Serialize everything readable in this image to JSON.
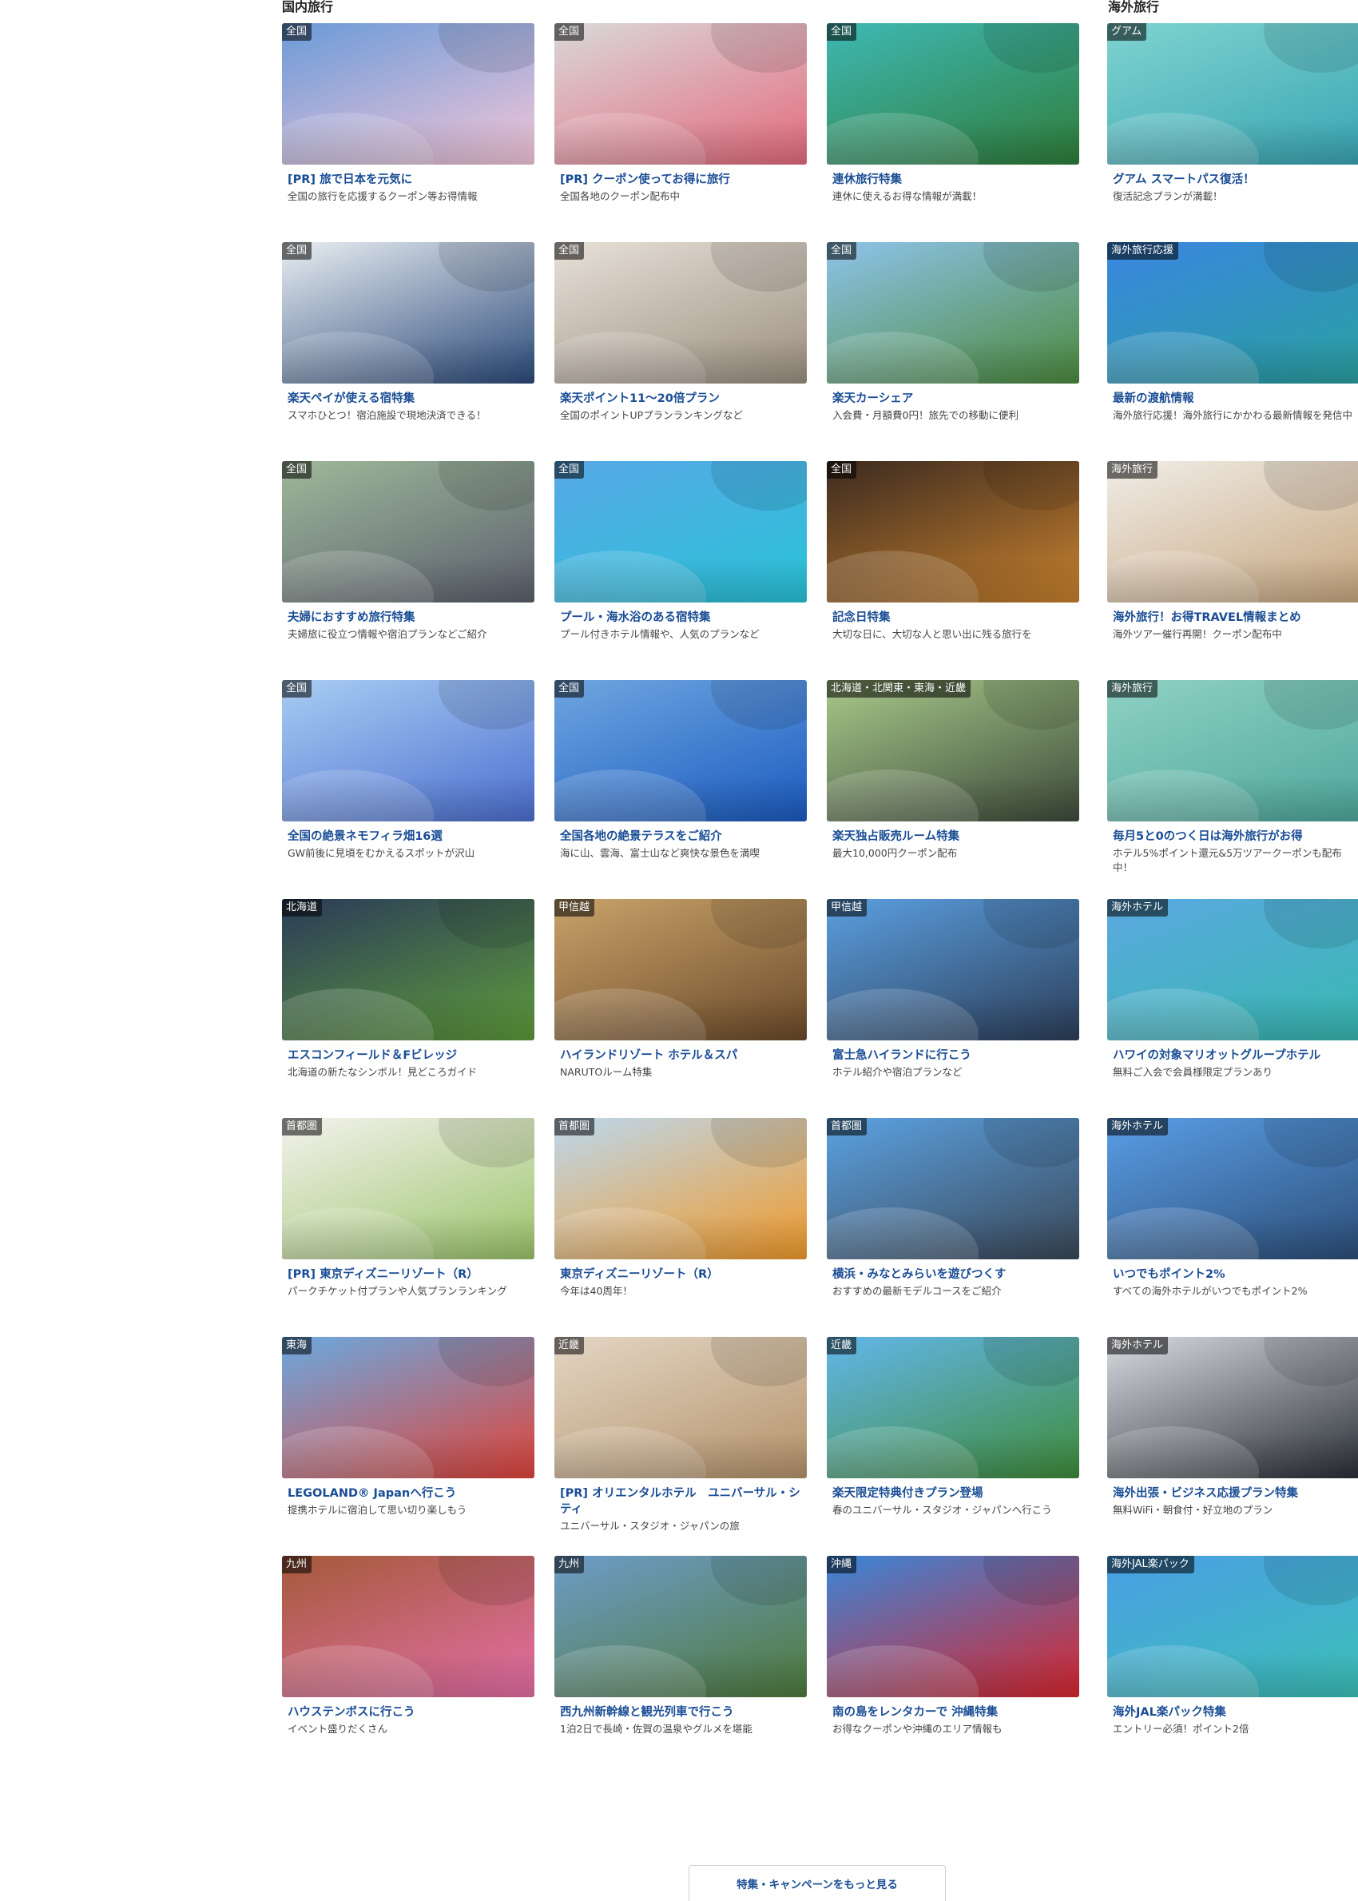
{
  "domestic": {
    "heading": "国内旅行",
    "cards": [
      {
        "badge": "全国",
        "title": "[PR] 旅で日本を元気に",
        "desc": "全国の旅行を応援するクーポン等お得情報",
        "c1": "#6a9ad8",
        "c2": "#f4c6d8"
      },
      {
        "badge": "全国",
        "title": "[PR] クーポン使ってお得に旅行",
        "desc": "全国各地のクーポン配布中",
        "c1": "#d9d9d9",
        "c2": "#e46a7e"
      },
      {
        "badge": "全国",
        "title": "連休旅行特集",
        "desc": "連休に使えるお得な情報が満載！",
        "c1": "#3fb8b4",
        "c2": "#2f7d3a"
      },
      {
        "badge": "全国",
        "title": "楽天ペイが使える宿特集",
        "desc": "スマホひとつ！宿泊施設で現地決済できる！",
        "c1": "#e9eef2",
        "c2": "#2c4a7a"
      },
      {
        "badge": "全国",
        "title": "楽天ポイント11～20倍プラン",
        "desc": "全国のポイントUPプランランキングなど",
        "c1": "#e7e1d8",
        "c2": "#9b8e80"
      },
      {
        "badge": "全国",
        "title": "楽天カーシェア",
        "desc": "入会費・月額費0円！旅先での移動に便利",
        "c1": "#8ec3ea",
        "c2": "#4c8a3e"
      },
      {
        "badge": "全国",
        "title": "夫婦におすすめ旅行特集",
        "desc": "夫婦旅に役立つ情報や宿泊プランなどご紹介",
        "c1": "#9fb89a",
        "c2": "#5a5f6d"
      },
      {
        "badge": "全国",
        "title": "プール・海水浴のある宿特集",
        "desc": "プール付きホテル情報や、人気のプランなど",
        "c1": "#58a8e6",
        "c2": "#28c3d8"
      },
      {
        "badge": "全国",
        "title": "記念日特集",
        "desc": "大切な日に、大切な人と思い出に残る旅行を",
        "c1": "#3b2a20",
        "c2": "#c9822e"
      },
      {
        "badge": "全国",
        "title": "全国の絶景ネモフィラ畑16選",
        "desc": "GW前後に見頃をむかえるスポットが沢山",
        "c1": "#a9cdf2",
        "c2": "#4c6fd0"
      },
      {
        "badge": "全国",
        "title": "全国各地の絶景テラスをご紹介",
        "desc": "海に山、雲海、富士山など爽快な景色を満喫",
        "c1": "#6fa6e0",
        "c2": "#1b5bc0"
      },
      {
        "badge": "北海道・北関東・東海・近畿",
        "title": "楽天独占販売ルーム特集",
        "desc": "最大10,000円クーポン配布",
        "c1": "#a8c98a",
        "c2": "#3d4a3a"
      },
      {
        "badge": "北海道",
        "title": "エスコンフィールド＆Fビレッジ",
        "desc": "北海道の新たなシンボル！見どころガイド",
        "c1": "#2b3b58",
        "c2": "#5e9b3c"
      },
      {
        "badge": "甲信越",
        "title": "ハイランドリゾート ホテル＆スパ",
        "desc": "NARUTOルーム特集",
        "c1": "#c9a36a",
        "c2": "#6b4a2a"
      },
      {
        "badge": "甲信越",
        "title": "富士急ハイランドに行こう",
        "desc": "ホテル紹介や宿泊プランなど",
        "c1": "#5b9fe0",
        "c2": "#2c3e58"
      },
      {
        "badge": "首都圏",
        "title": "[PR] 東京ディズニーリゾート（R）",
        "desc": "パークチケット付プランや人気プランランキング",
        "c1": "#f4f2ee",
        "c2": "#9bc46a"
      },
      {
        "badge": "首都圏",
        "title": "東京ディズニーリゾート（R）",
        "desc": "今年は40周年！",
        "c1": "#bcd8ee",
        "c2": "#f09a2a"
      },
      {
        "badge": "首都圏",
        "title": "横浜・みなとみらいを遊びつくす",
        "desc": "おすすめの最新モデルコースをご紹介",
        "c1": "#5ba2e2",
        "c2": "#3a4756"
      },
      {
        "badge": "東海",
        "title": "LEGOLAND® Japanへ行こう",
        "desc": "提携ホテルに宿泊して思い切り楽しもう",
        "c1": "#6aa9e0",
        "c2": "#e0443a"
      },
      {
        "badge": "近畿",
        "title": "[PR] オリエンタルホテル　ユニバーサル・シティ",
        "desc": "ユニバーサル・スタジオ・ジャパンの旅",
        "c1": "#e3d6c4",
        "c2": "#b4926a"
      },
      {
        "badge": "近畿",
        "title": "楽天限定特典付きプラン登場",
        "desc": "春のユニバーサル・スタジオ・ジャパンへ行こう",
        "c1": "#63b6ea",
        "c2": "#3f8c3a"
      },
      {
        "badge": "九州",
        "title": "ハウステンボスに行こう",
        "desc": "イベント盛りだくさん",
        "c1": "#a45a3a",
        "c2": "#e46fa6"
      },
      {
        "badge": "九州",
        "title": "西九州新幹線と観光列車で行こう",
        "desc": "1泊2日で長崎・佐賀の温泉やグルメを堪能",
        "c1": "#6d9cc8",
        "c2": "#4f7a3c"
      },
      {
        "badge": "沖縄",
        "title": "南の島をレンタカーで 沖縄特集",
        "desc": "お得なクーポンや沖縄のエリア情報も",
        "c1": "#3a86d8",
        "c2": "#d9262e"
      }
    ]
  },
  "international": {
    "heading": "海外旅行",
    "cards": [
      {
        "badge": "グアム",
        "title": "グアム スマートパス復活！",
        "desc": "復活記念プランが満載！",
        "c1": "#7fd3cf",
        "c2": "#3aa6b4"
      },
      {
        "badge": "海外旅行応援",
        "title": "最新の渡航情報",
        "desc": "海外旅行応援！海外旅行にかかわる最新情報を発信中",
        "c1": "#3a86e0",
        "c2": "#2aa0a0"
      },
      {
        "badge": "海外旅行",
        "title": "海外旅行！お得TRAVEL情報まとめ",
        "desc": "海外ツアー催行再開！クーポン配布中",
        "c1": "#f0ede8",
        "c2": "#c7a77f"
      },
      {
        "badge": "海外旅行",
        "title": "毎月5と0のつく日は海外旅行がお得",
        "desc": "ホテル5%ポイント還元&5万ツアークーポンも配布中！",
        "c1": "#8fd1c4",
        "c2": "#4fa89c"
      },
      {
        "badge": "海外ホテル",
        "title": "ハワイの対象マリオットグループホテル",
        "desc": "無料ご入会で会員様限定プランあり",
        "c1": "#5aa8e0",
        "c2": "#38b8b0"
      },
      {
        "badge": "海外ホテル",
        "title": "いつでもポイント2%",
        "desc": "すべての海外ホテルがいつでもポイント2%",
        "c1": "#5a9ee6",
        "c2": "#2c4e78"
      },
      {
        "badge": "海外ホテル",
        "title": "海外出張・ビジネス応援プラン特集",
        "desc": "無料WiFi・朝食付・好立地のプラン",
        "c1": "#d8dbe0",
        "c2": "#2a2e36"
      },
      {
        "badge": "海外JAL楽パック",
        "title": "海外JAL楽パック特集",
        "desc": "エントリー必須！ポイント2倍",
        "c1": "#4a9ee4",
        "c2": "#3cc0b8"
      }
    ]
  },
  "more_button": {
    "label": "特集・キャンペーンをもっと見る"
  }
}
